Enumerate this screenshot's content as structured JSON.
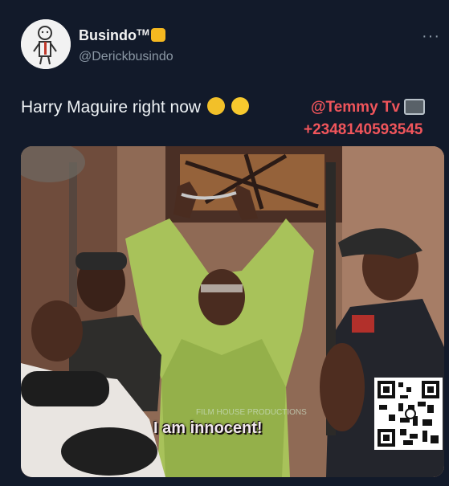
{
  "tweet": {
    "display_name": "Busindo",
    "tm": "TM",
    "handle": "@Derickbusindo",
    "more_label": "···",
    "text": "Harry Maguire right now",
    "watermark_name": "@Temmy Tv",
    "watermark_phone": "+2348140593545"
  },
  "media": {
    "subtitle": "I am innocent!",
    "small_caption": "FILM HOUSE PRODUCTIONS"
  },
  "icons": [
    "fist-emoji-icon",
    "pensive-face-icon",
    "grimacing-face-icon",
    "tv-icon",
    "qr-code-icon"
  ]
}
